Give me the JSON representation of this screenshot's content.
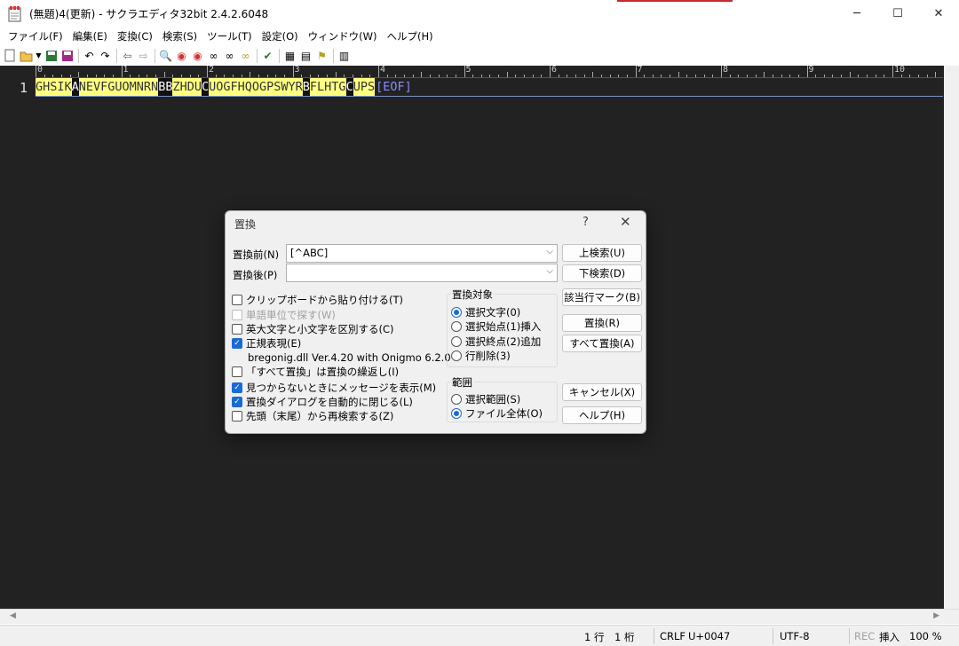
{
  "window": {
    "title": "(無題)4(更新) - サクラエディタ32bit 2.4.2.6048",
    "minimize": "─",
    "maximize": "☐",
    "close": "✕"
  },
  "menu": [
    "ファイル(F)",
    "編集(E)",
    "変換(C)",
    "検索(S)",
    "ツール(T)",
    "設定(O)",
    "ウィンドウ(W)",
    "ヘルプ(H)"
  ],
  "toolbar_icons": [
    "new-file-icon",
    "open-file-icon",
    "dropdown-icon",
    "save-icon",
    "save-as-icon",
    "undo-icon",
    "redo-icon",
    "jump-back-icon",
    "jump-forward-icon",
    "search-icon",
    "search-next-icon",
    "search-prev-icon",
    "replace-icon",
    "mark-icon",
    "highlight-icon",
    "grep-icon",
    "compare-icon",
    "outline-icon",
    "macro-icon",
    "settings-icon"
  ],
  "editor": {
    "line_number": "1",
    "ruler_numbers": [
      "0",
      "1",
      "2",
      "3",
      "4",
      "5",
      "6",
      "7",
      "8",
      "9",
      "10"
    ],
    "segments": [
      {
        "text": "GHSIK",
        "style": "hl"
      },
      {
        "text": "A",
        "style": "dark"
      },
      {
        "text": "NEVFGUOMNRN",
        "style": "hl"
      },
      {
        "text": "BB",
        "style": "dark"
      },
      {
        "text": "ZHDU",
        "style": "hl"
      },
      {
        "text": "C",
        "style": "dark"
      },
      {
        "text": "UOGFHQOGPSWYR",
        "style": "hl"
      },
      {
        "text": "B",
        "style": "dark"
      },
      {
        "text": "FLHTG",
        "style": "hl"
      },
      {
        "text": "C",
        "style": "dark"
      },
      {
        "text": "UPS",
        "style": "hl"
      },
      {
        "text": "[EOF]",
        "style": "eof"
      }
    ],
    "scroll_left": "◀",
    "scroll_right": "▶"
  },
  "status": {
    "position": "1 行　1 桁",
    "eol": "CRLF",
    "char_code": "U+0047",
    "encoding": "UTF-8",
    "rec": "REC",
    "mode": "挿入",
    "zoom": "100 %"
  },
  "dialog": {
    "title": "置換",
    "help": "?",
    "close": "✕",
    "before_label": "置換前(N)",
    "before_value": "[^ABC]",
    "after_label": "置換後(P)",
    "after_value": "",
    "buttons": {
      "search_up": "上検索(U)",
      "search_down": "下検索(D)",
      "mark": "該当行マーク(B)",
      "replace": "置換(R)",
      "replace_all": "すべて置換(A)",
      "cancel": "キャンセル(X)",
      "help": "ヘルプ(H)"
    },
    "options": [
      {
        "label": "クリップボードから貼り付ける(T)",
        "checked": false,
        "disabled": false
      },
      {
        "label": "単語単位で探す(W)",
        "checked": false,
        "disabled": true
      },
      {
        "label": "英大文字と小文字を区別する(C)",
        "checked": false,
        "disabled": false
      },
      {
        "label": "正規表現(E)",
        "checked": true,
        "disabled": false
      }
    ],
    "regex_info": "bregonig.dll Ver.4.20 with Onigmo 6.2.0",
    "options2": [
      {
        "label": "「すべて置換」は置換の繰返し(I)",
        "checked": false
      },
      {
        "label": "見つからないときにメッセージを表示(M)",
        "checked": true
      },
      {
        "label": "置換ダイアログを自動的に閉じる(L)",
        "checked": true
      },
      {
        "label": "先頭（末尾）から再検索する(Z)",
        "checked": false
      }
    ],
    "target_group": {
      "title": "置換対象",
      "options": [
        "選択文字(0)",
        "選択始点(1)挿入",
        "選択終点(2)追加",
        "行削除(3)"
      ],
      "selected": 0
    },
    "range_group": {
      "title": "範囲",
      "options": [
        "選択範囲(S)",
        "ファイル全体(O)"
      ],
      "selected": 1
    }
  }
}
